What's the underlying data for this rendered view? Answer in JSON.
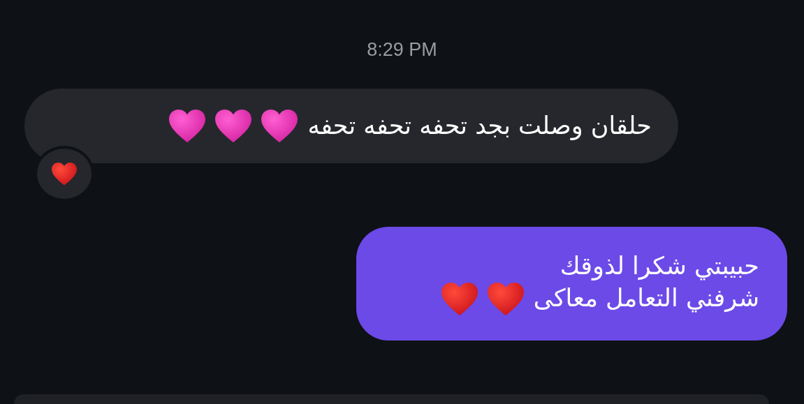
{
  "timestamp": "8:29 PM",
  "messages": [
    {
      "kind": "incoming",
      "lines": [
        {
          "text": "حلقان وصلت بجد تحفه تحفه تحفه",
          "icons": [
            {
              "kind": "pink-heart"
            },
            {
              "kind": "pink-heart"
            },
            {
              "kind": "pink-heart"
            }
          ]
        }
      ],
      "reactions": [
        {
          "kind": "red-heart"
        }
      ]
    },
    {
      "kind": "outgoing",
      "lines": [
        {
          "text": "حبيبتي شكرا لذوقك"
        },
        {
          "text": "شرفني التعامل معاكى",
          "icons": [
            {
              "kind": "red-heart"
            },
            {
              "kind": "red-heart"
            }
          ]
        }
      ]
    }
  ]
}
